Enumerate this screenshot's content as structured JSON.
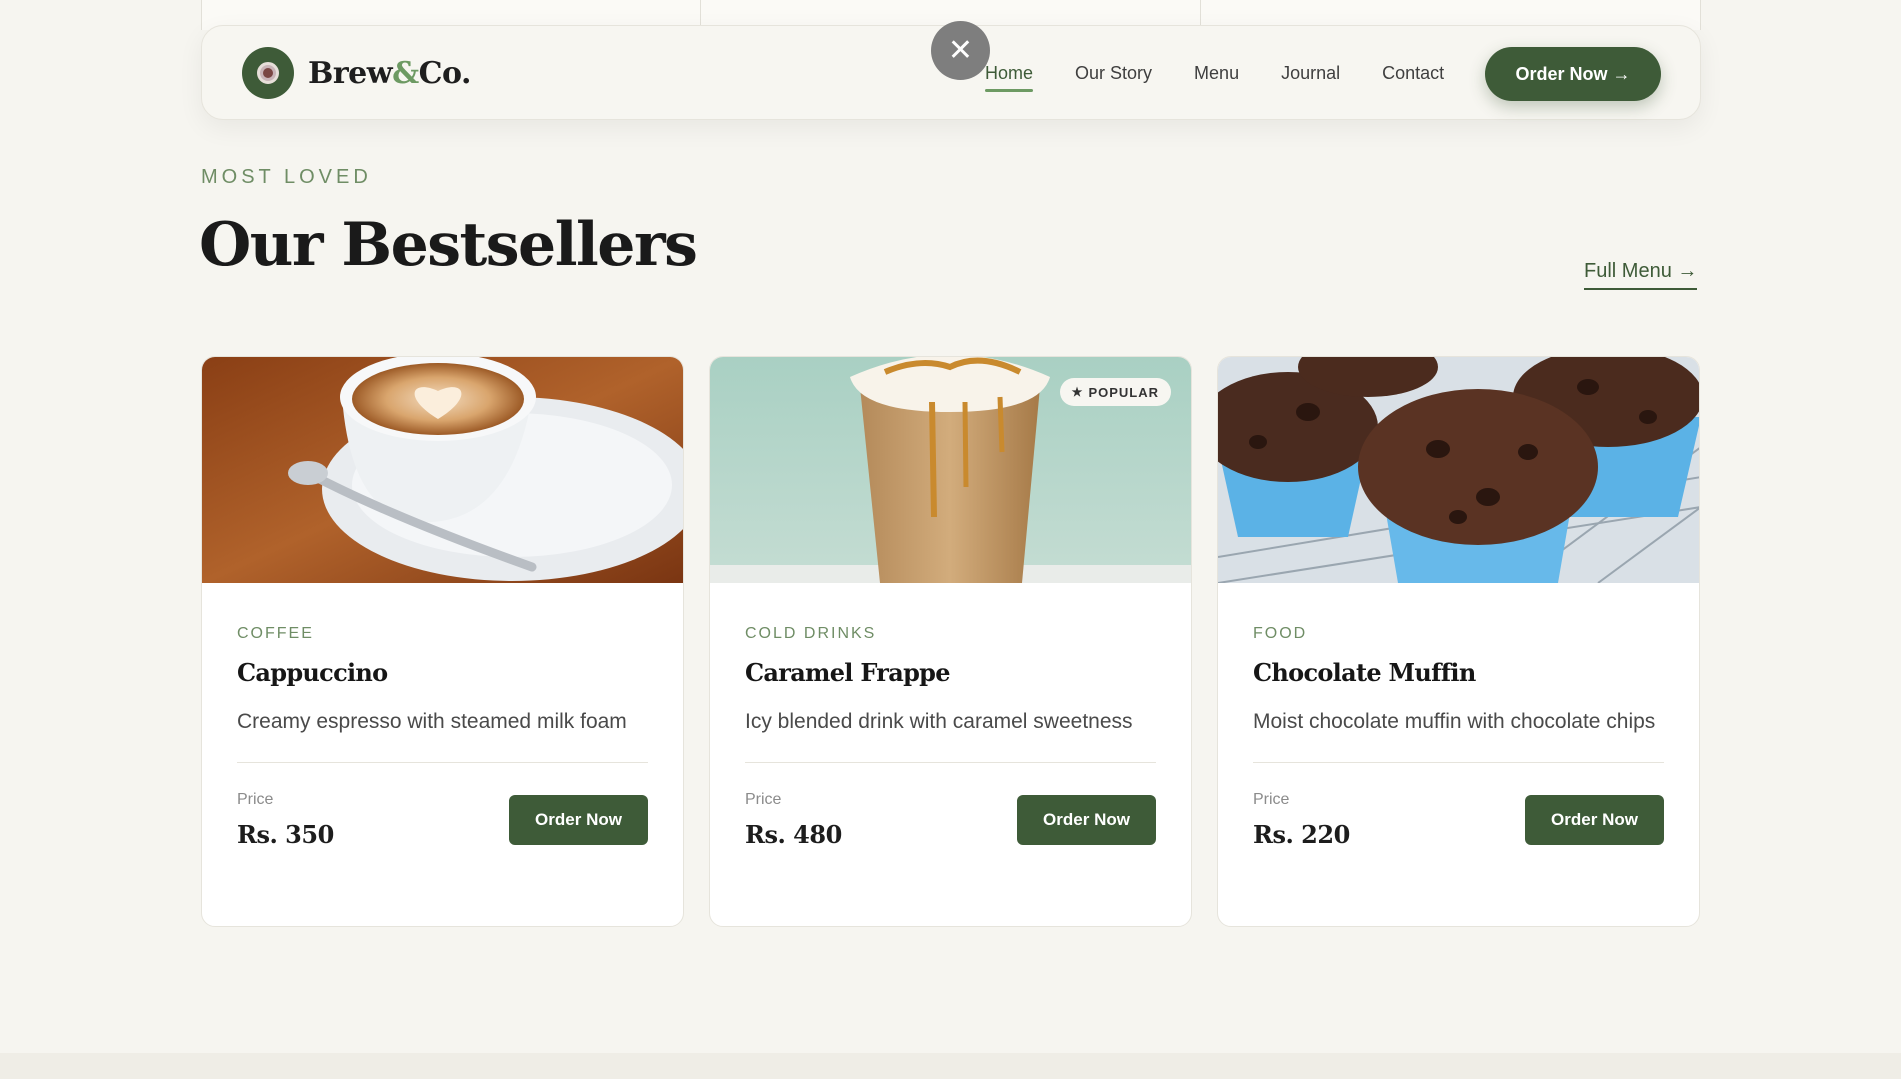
{
  "brand": {
    "name_part1": "Brew",
    "name_amp": "&",
    "name_part2": "Co."
  },
  "nav": {
    "links": [
      "Home",
      "Our Story",
      "Menu",
      "Journal",
      "Contact"
    ],
    "active": "Home",
    "order_button": "Order Now →",
    "close_symbol": "✕"
  },
  "section": {
    "eyebrow": "MOST LOVED",
    "title": "Our Bestsellers",
    "full_menu_link": "Full Menu →"
  },
  "products": [
    {
      "category": "COFFEE",
      "name": "Cappuccino",
      "description": "Creamy espresso with steamed milk foam",
      "price_label": "Price",
      "price": "Rs. 350",
      "order_label": "Order Now"
    },
    {
      "category": "COLD DRINKS",
      "name": "Caramel Frappe",
      "description": "Icy blended drink with caramel sweetness",
      "price_label": "Price",
      "price": "Rs. 480",
      "order_label": "Order Now",
      "badge": "POPULAR",
      "badge_icon": "★"
    },
    {
      "category": "FOOD",
      "name": "Chocolate Muffin",
      "description": "Moist chocolate muffin with chocolate chips",
      "price_label": "Price",
      "price": "Rs. 220",
      "order_label": "Order Now"
    }
  ],
  "colors": {
    "brand_green": "#3e5b38",
    "accent_green": "#6d9a63",
    "background": "#f6f5f0"
  }
}
